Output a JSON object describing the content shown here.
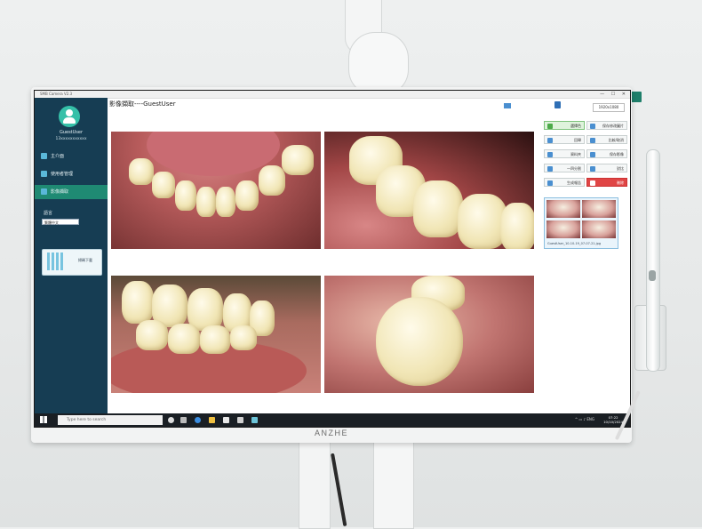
{
  "monitor": {
    "brand": "ANZHE"
  },
  "window": {
    "title": "SMB Camera V2.3"
  },
  "sidebar": {
    "user_name": "GuestUser",
    "user_id": "13xxxxxxxxxxx",
    "items": [
      {
        "label": "主介面"
      },
      {
        "label": "使用者管理"
      },
      {
        "label": "影像擷取"
      }
    ],
    "language_label": "語言",
    "language_value": "繁體中文",
    "qr_label": "掃碼下載"
  },
  "header": {
    "title": "影像擷取----GuestUser",
    "resolution": "1920x1080"
  },
  "right_panel": {
    "buttons": [
      {
        "label": "選擇色",
        "style": "green"
      },
      {
        "label": "保存修改圖片",
        "style": "normal"
      },
      {
        "label": "回歸",
        "style": "normal"
      },
      {
        "label": "比較/取消",
        "style": "normal"
      },
      {
        "label": "資料夾",
        "style": "normal"
      },
      {
        "label": "保存影像",
        "style": "normal"
      },
      {
        "label": "一四分割",
        "style": "normal"
      },
      {
        "label": "對比",
        "style": "normal"
      },
      {
        "label": "生成報告",
        "style": "normal"
      },
      {
        "label": "刪除",
        "style": "red"
      }
    ],
    "thumbnail_caption": "GuestUser_10-10-19_07-07-21.jpg"
  },
  "taskbar": {
    "search_placeholder": "Type here to search",
    "time": "07:22",
    "date": "10/10/2024"
  }
}
